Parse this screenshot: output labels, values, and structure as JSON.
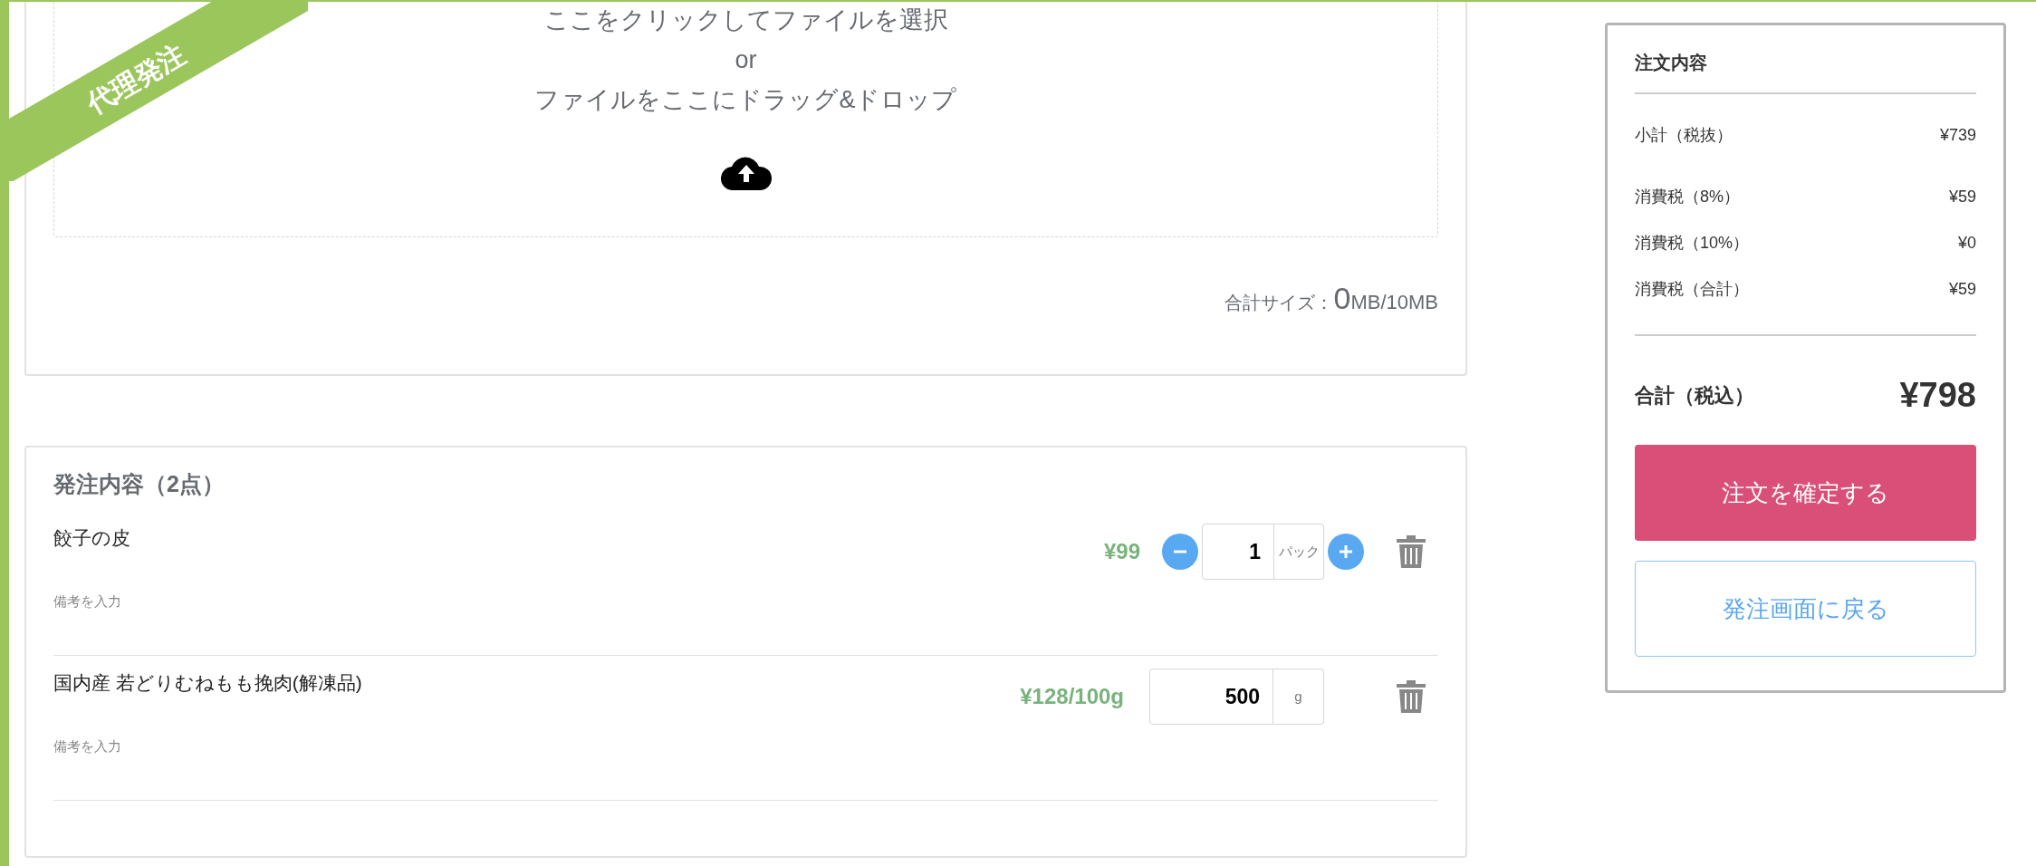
{
  "ribbon": "代理発注",
  "upload": {
    "lines": [
      "ここをクリックしてファイルを選択",
      "or",
      "ファイルをここにドラッグ&ドロップ"
    ],
    "size_label": "合計サイズ：",
    "size_value": "0",
    "size_unit": "MB/10MB"
  },
  "order_items": {
    "title": "発注内容（2点）",
    "items": [
      {
        "kind": "stepper",
        "name": "餃子の皮",
        "price": "¥99",
        "quantity": "1",
        "unit": "パック",
        "remark_placeholder": "備考を入力"
      },
      {
        "kind": "plain",
        "name": "国内産 若どりむねもも挽肉(解凍品)",
        "price": "¥128/100g",
        "quantity": "500",
        "unit": "g",
        "remark_placeholder": "備考を入力"
      }
    ]
  },
  "summary": {
    "title": "注文内容",
    "rows": [
      {
        "label": "小計（税抜）",
        "value": "¥739"
      },
      {
        "label": "消費税（8%）",
        "value": "¥59"
      },
      {
        "label": "消費税（10%）",
        "value": "¥0"
      },
      {
        "label": "消費税（合計）",
        "value": "¥59"
      }
    ],
    "total_label": "合計（税込）",
    "total_value": "¥798",
    "confirm_button": "注文を確定する",
    "back_button": "発注画面に戻る"
  }
}
